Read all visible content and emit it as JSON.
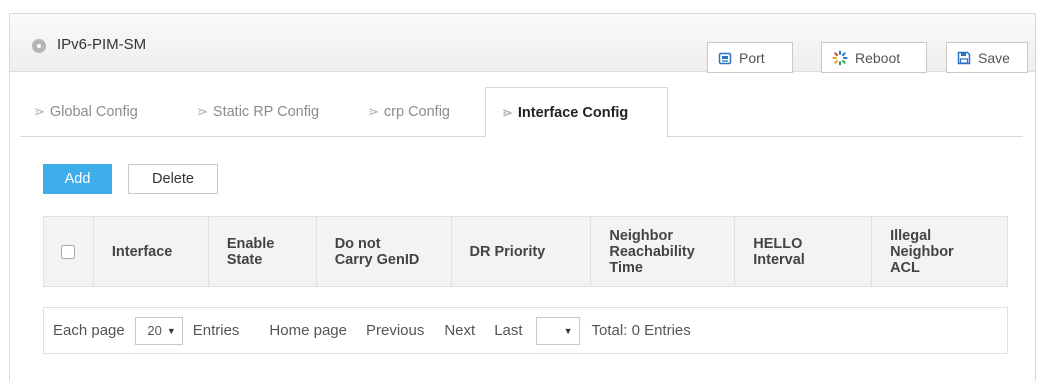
{
  "header": {
    "title": "IPv6-PIM-SM",
    "buttons": {
      "port": "Port",
      "reboot": "Reboot",
      "save": "Save"
    }
  },
  "tabs": [
    {
      "label": "Global Config"
    },
    {
      "label": "Static RP Config"
    },
    {
      "label": "crp Config"
    },
    {
      "label": "Interface Config",
      "active": true
    }
  ],
  "actions": {
    "add": "Add",
    "delete": "Delete"
  },
  "table": {
    "columns": [
      {
        "lines": [
          "Interface"
        ]
      },
      {
        "lines": [
          "Enable",
          "State"
        ]
      },
      {
        "lines": [
          "Do not",
          "Carry GenID"
        ]
      },
      {
        "lines": [
          "DR Priority"
        ]
      },
      {
        "lines": [
          "Neighbor",
          "Reachability",
          "Time"
        ]
      },
      {
        "lines": [
          "HELLO",
          "Interval"
        ]
      },
      {
        "lines": [
          "Illegal",
          "Neighbor",
          "ACL"
        ]
      }
    ],
    "rows": []
  },
  "pager": {
    "each_page": "Each page",
    "page_size": "20",
    "entries": "Entries",
    "home": "Home page",
    "previous": "Previous",
    "next": "Next",
    "last": "Last",
    "page_select": "",
    "total": "Total: 0 Entries"
  },
  "colors": {
    "accent": "#3daeea",
    "header_bg": "#f3f3f3",
    "border": "#e0e0e0"
  },
  "icons": {
    "title": "location-pin-icon",
    "port": "port-icon",
    "reboot": "reboot-spinner-icon",
    "save": "floppy-disk-icon"
  }
}
